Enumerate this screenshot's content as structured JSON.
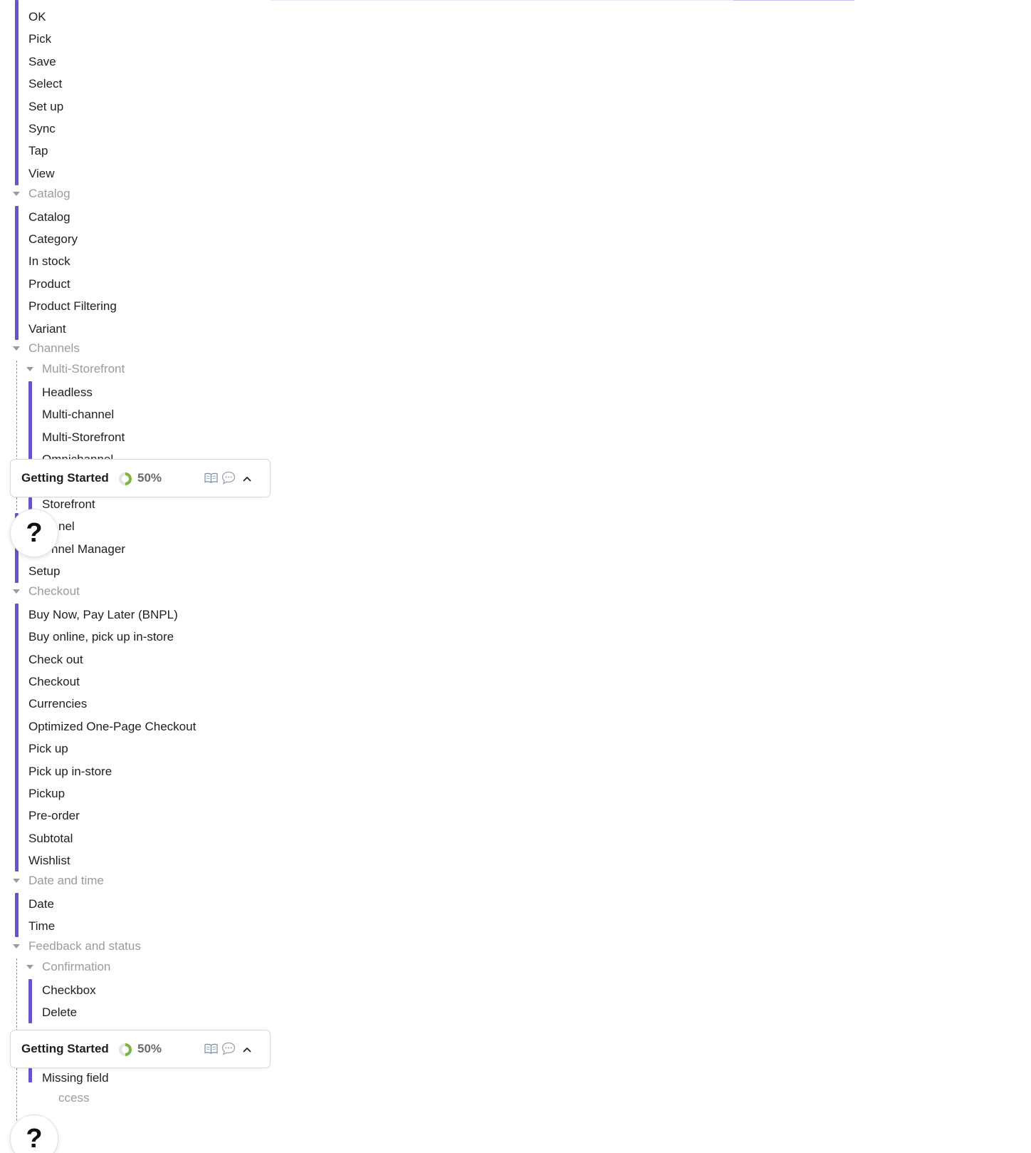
{
  "tree": {
    "actions": [
      "OK",
      "Pick",
      "Save",
      "Select",
      "Set up",
      "Sync",
      "Tap",
      "View"
    ],
    "catalog": {
      "heading": "Catalog",
      "items": [
        "Catalog",
        "Category",
        "In stock",
        "Product",
        "Product Filtering",
        "Variant"
      ]
    },
    "channels": {
      "heading": "Channels",
      "multi_storefront": {
        "heading": "Multi-Storefront",
        "items": [
          "Headless",
          "Multi-channel",
          "Multi-Storefront",
          "Omnichannel",
          "Storefront"
        ]
      },
      "partial_items": [
        "nel",
        "nnel Manager"
      ],
      "setup": "Setup"
    },
    "checkout": {
      "heading": "Checkout",
      "items": [
        "Buy Now, Pay Later (BNPL)",
        "Buy online, pick up in-store",
        "Check out",
        "Checkout",
        "Currencies",
        "Optimized One-Page Checkout",
        "Pick up",
        "Pick up in-store",
        "Pickup",
        "Pre-order",
        "Subtotal",
        "Wishlist"
      ]
    },
    "date_time": {
      "heading": "Date and time",
      "items": [
        "Date",
        "Time"
      ]
    },
    "feedback": {
      "heading": "Feedback and status",
      "confirmation": {
        "heading": "Confirmation",
        "items": [
          "Checkbox",
          "Delete",
          "Missing field"
        ]
      },
      "success_partial": "ccess"
    }
  },
  "widget": {
    "title": "Getting Started",
    "progress": 0.5,
    "progress_label": "50%",
    "progress_color": "#7cb342",
    "icons": [
      "book-icon",
      "chat-icon",
      "chevron-up-icon"
    ]
  },
  "help": {
    "label": "?"
  },
  "colors": {
    "accent": "#6a53c9",
    "muted": "#9b9b9b"
  }
}
